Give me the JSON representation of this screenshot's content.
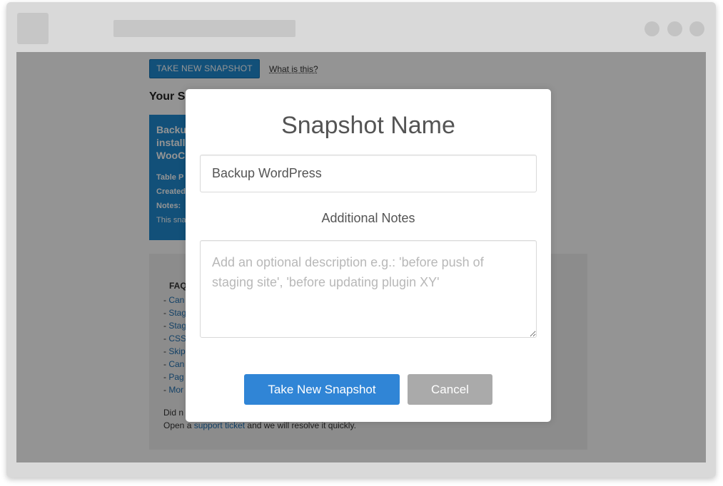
{
  "window": {
    "controls": [
      "window-dot-icon",
      "window-dot-icon",
      "window-dot-icon"
    ]
  },
  "page": {
    "take_snapshot_button": "TAKE NEW SNAPSHOT",
    "what_is_this_link": "What is this?",
    "snapshots_title": "Your S",
    "snapshot_card": {
      "title_lines": [
        "Backu",
        "install",
        "WooC"
      ],
      "table_prefix_label": "Table P",
      "created_label": "Created",
      "notes_label": "Notes:",
      "notes_text": "This sna"
    },
    "faq": {
      "title": "FAQ",
      "items": [
        {
          "bullet": "- ",
          "text": "Can"
        },
        {
          "bullet": "- ",
          "text": "Stag"
        },
        {
          "bullet": "- ",
          "text": "Stag"
        },
        {
          "bullet": "- ",
          "text": "CSS"
        },
        {
          "bullet": "- ",
          "text": "Skip"
        },
        {
          "bullet": "- ",
          "text": "Can"
        },
        {
          "bullet": "- ",
          "text": "Pag"
        },
        {
          "bullet": "- ",
          "text": "Mor"
        }
      ],
      "note_line1": "Did n",
      "note_line2_prefix": "Open a ",
      "support_link": "support ticket",
      "note_line2_suffix": " and we will resolve it quickly."
    }
  },
  "modal": {
    "title": "Snapshot Name",
    "name_input_value": "Backup WordPress",
    "notes_label": "Additional Notes",
    "notes_placeholder": "Add an optional description e.g.: 'before push of staging site', 'before updating plugin XY'",
    "confirm_button": "Take New Snapshot",
    "cancel_button": "Cancel"
  },
  "colors": {
    "primary": "#3085d6",
    "page_button": "#1f8ad1",
    "cancel": "#aaaaaa",
    "overlay": "rgba(0,0,0,0.42)"
  }
}
